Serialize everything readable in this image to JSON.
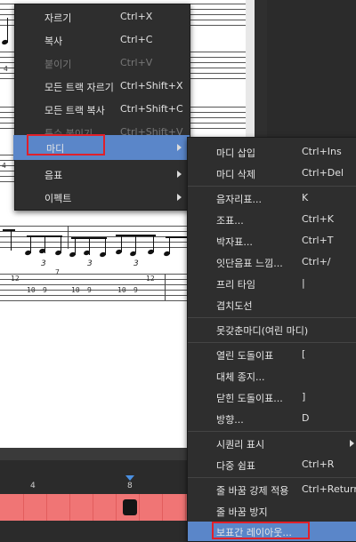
{
  "timeline": {
    "ruler_labels": [
      "4",
      "8"
    ]
  },
  "score": {
    "tab_numbers_row1": [
      "4"
    ],
    "tab_numbers_row2": [
      "4"
    ],
    "tab_numbers_row3": [
      "12",
      "7",
      "12",
      "10",
      "9",
      "10",
      "9",
      "10",
      "9"
    ],
    "triplet_label": "3"
  },
  "context_menu": {
    "items": [
      {
        "label": "자르기",
        "shortcut": "Ctrl+X",
        "enabled": true
      },
      {
        "label": "복사",
        "shortcut": "Ctrl+C",
        "enabled": true
      },
      {
        "label": "붙이기",
        "shortcut": "Ctrl+V",
        "enabled": false
      },
      {
        "label": "모든 트랙 자르기",
        "shortcut": "Ctrl+Shift+X",
        "enabled": true
      },
      {
        "label": "모든 트랙 복사",
        "shortcut": "Ctrl+Shift+C",
        "enabled": true
      },
      {
        "label": "특수 붙이기...",
        "shortcut": "Ctrl+Shift+V",
        "enabled": false
      },
      {
        "label": "마디",
        "shortcut": "",
        "enabled": true,
        "submenu": true,
        "highlighted": true
      },
      {
        "label": "음표",
        "shortcut": "",
        "enabled": true,
        "submenu": true
      },
      {
        "label": "이펙트",
        "shortcut": "",
        "enabled": true,
        "submenu": true
      }
    ]
  },
  "submenu": {
    "items": [
      {
        "label": "마디 삽입",
        "shortcut": "Ctrl+Ins"
      },
      {
        "label": "마디 삭제",
        "shortcut": "Ctrl+Del"
      },
      {
        "label": "음자리표...",
        "shortcut": "K"
      },
      {
        "label": "조표...",
        "shortcut": "Ctrl+K"
      },
      {
        "label": "박자표...",
        "shortcut": "Ctrl+T"
      },
      {
        "label": "잇단음표 느낌...",
        "shortcut": "Ctrl+/"
      },
      {
        "label": "프리 타임",
        "shortcut": "|"
      },
      {
        "label": "겹치도선",
        "shortcut": ""
      },
      {
        "label": "못갖춘마디(여린 마디)",
        "shortcut": ""
      },
      {
        "label": "열린 도돌이표",
        "shortcut": "["
      },
      {
        "label": "대체 종지...",
        "shortcut": ""
      },
      {
        "label": "닫힌 도돌이표...",
        "shortcut": "]"
      },
      {
        "label": "방향...",
        "shortcut": "D"
      },
      {
        "label": "시퀀리 표시",
        "shortcut": "",
        "submenu": true
      },
      {
        "label": "다중 쉼표",
        "shortcut": "Ctrl+R"
      },
      {
        "label": "줄 바꿈 강제 적용",
        "shortcut": "Ctrl+Return"
      },
      {
        "label": "줄 바꿈 방지",
        "shortcut": ""
      },
      {
        "label": "보표간 레이아웃...",
        "shortcut": "",
        "highlighted": true
      }
    ]
  }
}
